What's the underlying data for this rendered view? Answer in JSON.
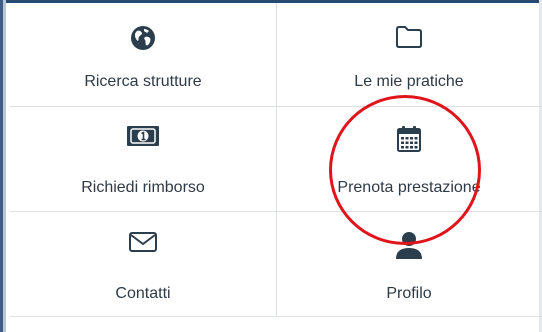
{
  "colors": {
    "header_bar": "#274a72",
    "icon": "#2b3e4e",
    "label": "#2f3a45",
    "divider": "#dcdfe3",
    "annotation": "#e0151b"
  },
  "menu": {
    "items": [
      {
        "label": "Ricerca strutture",
        "icon": "globe-icon"
      },
      {
        "label": "Le mie pratiche",
        "icon": "folder-icon"
      },
      {
        "label": "Richiedi rimborso",
        "icon": "money-icon"
      },
      {
        "label": "Prenota prestazione",
        "icon": "calendar-icon"
      },
      {
        "label": "Contatti",
        "icon": "envelope-icon"
      },
      {
        "label": "Profilo",
        "icon": "user-icon"
      }
    ]
  },
  "annotation": {
    "shape": "circle",
    "target": "Prenota prestazione"
  }
}
